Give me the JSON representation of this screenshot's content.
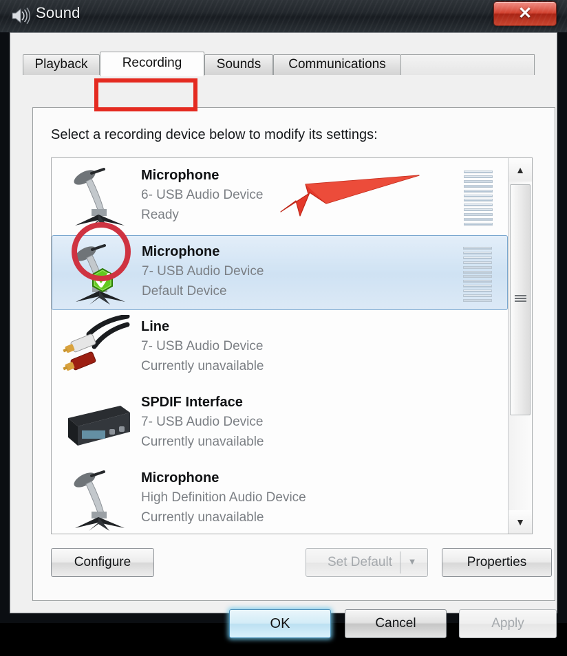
{
  "window": {
    "title": "Sound",
    "title_icon": "speaker-icon",
    "close_label": "✕"
  },
  "tabs": [
    {
      "id": "playback",
      "label": "Playback",
      "active": false
    },
    {
      "id": "recording",
      "label": "Recording",
      "active": true
    },
    {
      "id": "sounds",
      "label": "Sounds",
      "active": false
    },
    {
      "id": "communications",
      "label": "Communications",
      "active": false
    }
  ],
  "panel": {
    "instruction": "Select a recording device below to modify its settings:"
  },
  "devices": [
    {
      "name": "Microphone",
      "description": "6- USB Audio Device",
      "status": "Ready",
      "icon": "microphone-icon",
      "selected": false,
      "default_device": false
    },
    {
      "name": "Microphone",
      "description": "7- USB Audio Device",
      "status": "Default Device",
      "icon": "microphone-icon",
      "selected": true,
      "default_device": true
    },
    {
      "name": "Line",
      "description": "7- USB Audio Device",
      "status": "Currently unavailable",
      "icon": "rca-cable-icon",
      "selected": false,
      "default_device": false
    },
    {
      "name": "SPDIF Interface",
      "description": "7- USB Audio Device",
      "status": "Currently unavailable",
      "icon": "spdif-device-icon",
      "selected": false,
      "default_device": false
    },
    {
      "name": "Microphone",
      "description": "High Definition Audio Device",
      "status": "Currently unavailable",
      "icon": "microphone-icon",
      "selected": false,
      "default_device": false
    }
  ],
  "scrollbar": {
    "up_arrow": "▲",
    "down_arrow": "▼"
  },
  "buttons": {
    "configure": "Configure",
    "set_default": "Set Default",
    "set_default_caret": "▼",
    "properties": "Properties",
    "ok": "OK",
    "cancel": "Cancel",
    "apply": "Apply"
  },
  "annotations": {
    "tab_highlight_color": "#e42a20",
    "arrow_color": "#e4392b",
    "circle_color": "#cf3341"
  },
  "colors": {
    "selection_border": "#7aa7cf",
    "selection_fill": "#cfe2f3",
    "close_button_red": "#c9452f",
    "check_badge_green": "#5cc11e"
  }
}
